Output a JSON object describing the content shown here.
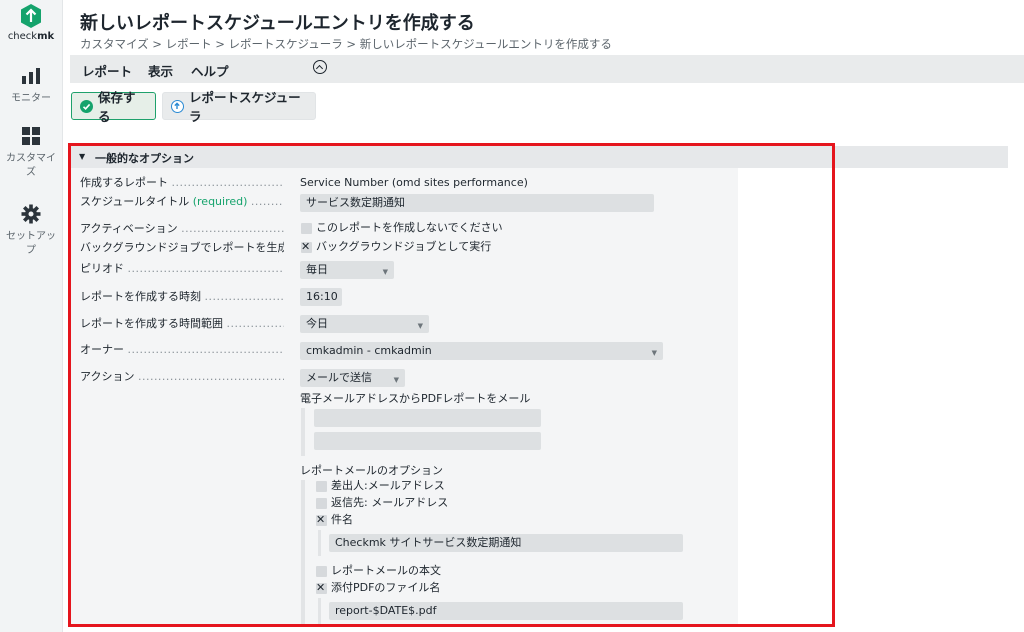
{
  "app": {
    "logo_name": "check",
    "logo_bold": "mk"
  },
  "sidebar": {
    "items": [
      {
        "label": "モニター",
        "icon": "bar-chart-icon"
      },
      {
        "label": "カスタマイズ",
        "icon": "grid-icon"
      },
      {
        "label": "セットアップ",
        "icon": "gear-icon"
      }
    ]
  },
  "header": {
    "title": "新しいレポートスケジュールエントリを作成する",
    "breadcrumb": "カスタマイズ > レポート > レポートスケジューラ > 新しいレポートスケジュールエントリを作成する"
  },
  "menu": {
    "items": [
      "レポート",
      "表示",
      "ヘルプ"
    ]
  },
  "toolbar": {
    "save_label": "保存する",
    "scheduler_label": "レポートスケジューラ"
  },
  "section": {
    "title": "一般的なオプション"
  },
  "form": {
    "report": {
      "label": "作成するレポート",
      "value": "Service Number (omd sites performance)"
    },
    "schedule_title": {
      "label": "スケジュールタイトル",
      "required": "(required)",
      "value": "サービス数定期通知"
    },
    "activation": {
      "label": "アクティベーション",
      "option": "このレポートを作成しないでください"
    },
    "background": {
      "label": "バックグラウンドジョブでレポートを生成",
      "option": "バックグラウンドジョブとして実行"
    },
    "period": {
      "label": "ピリオド",
      "value": "毎日"
    },
    "time": {
      "label": "レポートを作成する時刻",
      "value": "16:10"
    },
    "time_range": {
      "label": "レポートを作成する時間範囲",
      "value": "今日"
    },
    "owner": {
      "label": "オーナー",
      "value": "cmkadmin - cmkadmin"
    },
    "action": {
      "label": "アクション",
      "value": "メールで送信"
    },
    "email_heading": "電子メールアドレスからPDFレポートをメール",
    "email_options_heading": "レポートメールのオプション",
    "sender": "差出人:メールアドレス",
    "reply_to": "返信先: メールアドレス",
    "subject": {
      "label": "件名",
      "value": "Checkmk サイトサービス数定期通知"
    },
    "body": "レポートメールの本文",
    "attachment": {
      "label": "添付PDFのファイル名",
      "value": "report-$DATE$.pdf"
    }
  },
  "colors": {
    "accent_green": "#15a36c",
    "highlight_red": "#e5151d"
  }
}
